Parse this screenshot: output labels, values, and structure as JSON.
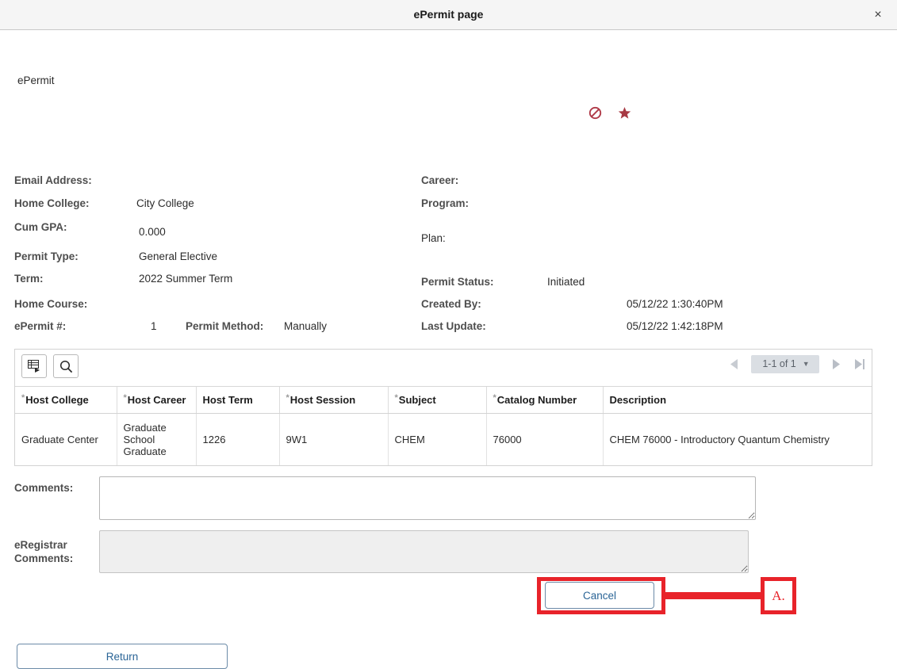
{
  "window": {
    "title": "ePermit page",
    "close_label": "×"
  },
  "breadcrumb": "ePermit",
  "header_icons": [
    {
      "name": "prohibited-icon",
      "color": "#b03a48"
    },
    {
      "name": "star-icon",
      "color": "#a73943"
    }
  ],
  "fields": {
    "left": [
      {
        "label": "Email Address:",
        "value": ""
      },
      {
        "label": "Home College:",
        "value": "City College"
      },
      {
        "label": "Cum GPA:",
        "value": "0.000"
      },
      {
        "label": "Permit Type:",
        "value": "General Elective"
      },
      {
        "label": "Term:",
        "value": "2022 Summer Term"
      },
      {
        "label": "Home Course:",
        "value": ""
      },
      {
        "label": "ePermit #:",
        "value": "1"
      }
    ],
    "permit_method_label": "Permit Method:",
    "permit_method_value": "Manually",
    "right": [
      {
        "label": "Career:",
        "value": ""
      },
      {
        "label": "Program:",
        "value": ""
      },
      {
        "label": "Plan:",
        "value": ""
      },
      {
        "label": "Permit Status:",
        "value": "Initiated"
      },
      {
        "label": "Created By:",
        "value": "05/12/22  1:30:40PM"
      },
      {
        "label": "Last Update:",
        "value": "05/12/22  1:42:18PM"
      }
    ]
  },
  "grid": {
    "toolbar": {
      "personalize_icon": "grid-personalize-icon",
      "find_icon": "search-icon"
    },
    "pager": {
      "first_prev_label": "◀",
      "count": "1-1 of 1",
      "chevron": "▼",
      "next_label": "▶",
      "last_label": "▶|"
    },
    "columns": [
      {
        "label": "Host College",
        "required": true
      },
      {
        "label": "Host Career",
        "required": true
      },
      {
        "label": "Host Term",
        "required": false
      },
      {
        "label": "Host Session",
        "required": true
      },
      {
        "label": "Subject",
        "required": true
      },
      {
        "label": "Catalog Number",
        "required": true
      },
      {
        "label": "Description",
        "required": false
      }
    ],
    "rows": [
      [
        "Graduate Center",
        "Graduate School Graduate",
        "1226",
        "9W1",
        "CHEM",
        "76000",
        "CHEM 76000 - Introductory Quantum Chemistry"
      ]
    ]
  },
  "comments": {
    "label": "Comments:",
    "value": "",
    "placeholder": ""
  },
  "eregistrar_comments": {
    "label_line1": "eRegistrar",
    "label_line2": "Comments:",
    "value": "",
    "placeholder": ""
  },
  "buttons": {
    "cancel": "Cancel",
    "return": "Return"
  },
  "annotation": {
    "letter": "A.",
    "color": "#e8232a"
  }
}
